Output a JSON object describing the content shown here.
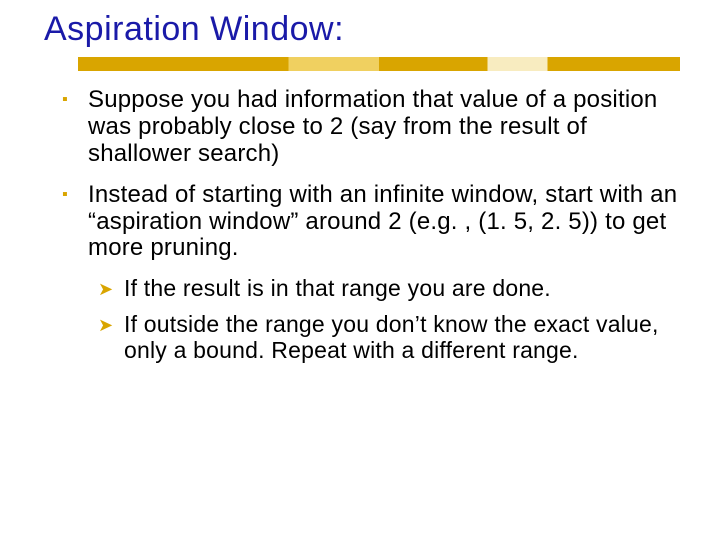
{
  "title": "Aspiration Window:",
  "bullets": [
    {
      "text": "Suppose you had information that value of a position was probably close to 2 (say from the result of shallower search)"
    },
    {
      "text": "Instead of starting with an infinite window, start with an “aspiration window” around 2 (e.g. , (1. 5, 2. 5)) to get more pruning.",
      "sub": [
        {
          "text": "If the result is in that range you are done."
        },
        {
          "text": "If outside the range you don’t know the exact value, only a bound. Repeat with a different range."
        }
      ]
    }
  ]
}
